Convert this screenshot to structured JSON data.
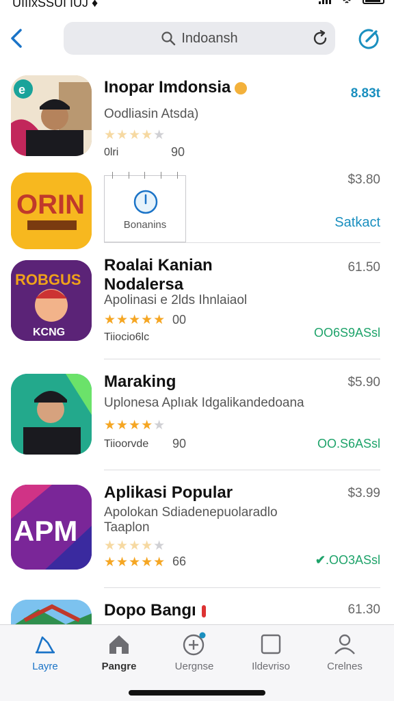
{
  "status_bar": {
    "carrier": "UIIIxSSUI IUJ ♦"
  },
  "search": {
    "placeholder": "Indoansh"
  },
  "colors": {
    "accent": "#1a73c7",
    "price_blue": "#1a8fbf",
    "action_green": "#1ea36a",
    "star": "#f5a623"
  },
  "apps": [
    {
      "title": "Inopar Imdonsia",
      "subtitle": "Oodliasin Atsda)",
      "rating": 4,
      "meta": "0lri",
      "count": "90",
      "price": "8.83t",
      "action": "",
      "icon": "person-cap-icon"
    },
    {
      "title": "",
      "banner_label": "Bonanins",
      "price": "$3.80",
      "action": "Satkact",
      "icon": "orin-logo-icon"
    },
    {
      "title": "Roalai Kanian",
      "title_line2": "Nodalersa",
      "subtitle": "Apolinasi e 2lds Ihnlaiaol",
      "rating": 5,
      "count": "00",
      "meta": "Tiiocio6lc",
      "price": "61.50",
      "action": "OO6S9ASsl",
      "icon": "kcng-mascot-icon"
    },
    {
      "title": "Maraking",
      "subtitle": "Uplonesa Aplıak Idgalikandedoana",
      "rating": 4,
      "count": "90",
      "meta": "Tiioorvde",
      "price": "$5.90",
      "action": "OO.S6ASsl",
      "icon": "person-cap-green-icon"
    },
    {
      "title": "Aplikasi Popular",
      "subtitle": "Apolokan Sdiadenepuolaradlo",
      "subtitle_line2": "Taaplon",
      "rating": 5,
      "count": "66",
      "price": "$3.99",
      "action": ".OO3ASsl",
      "icon": "apm-logo-icon"
    },
    {
      "title": "Dopo Bangı",
      "price": "61.30",
      "icon": "landscape-icon"
    }
  ],
  "tabs": [
    {
      "label": "Layre",
      "icon": "stack-icon"
    },
    {
      "label": "Pangre",
      "icon": "home-icon"
    },
    {
      "label": "Uergnse",
      "icon": "add-circle-icon"
    },
    {
      "label": "Ildevriso",
      "icon": "square-icon"
    },
    {
      "label": "Crelnes",
      "icon": "person-icon"
    }
  ]
}
